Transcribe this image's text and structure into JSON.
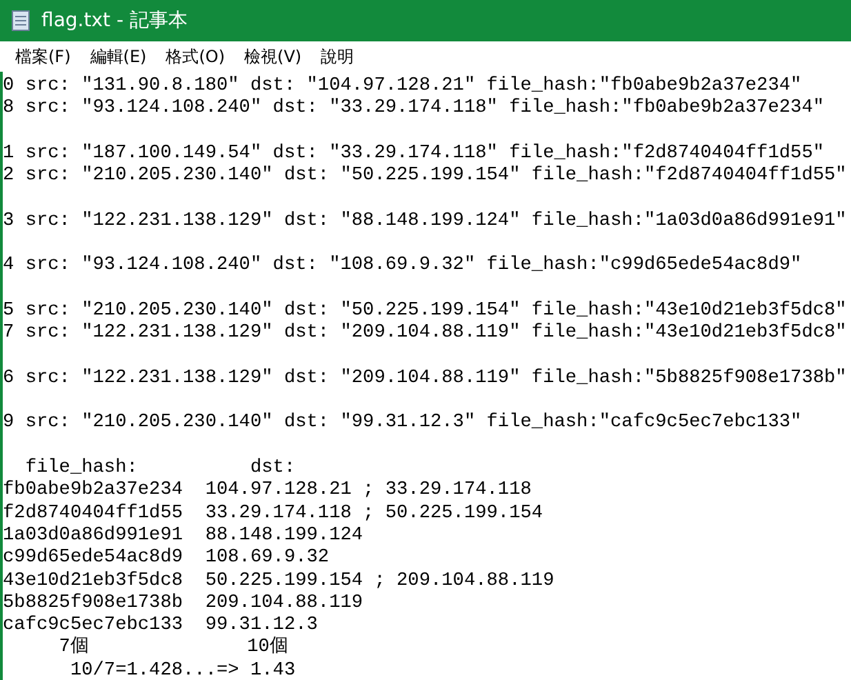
{
  "window": {
    "title": "flag.txt - 記事本"
  },
  "menu": [
    {
      "label": "檔案(F)"
    },
    {
      "label": "編輯(E)"
    },
    {
      "label": "格式(O)"
    },
    {
      "label": "檢視(V)"
    },
    {
      "label": "說明"
    }
  ],
  "document": {
    "blocks": [
      [
        "0 src: \"131.90.8.180\" dst: \"104.97.128.21\" file_hash:\"fb0abe9b2a37e234\"",
        "8 src: \"93.124.108.240\" dst: \"33.29.174.118\" file_hash:\"fb0abe9b2a37e234\""
      ],
      [
        "1 src: \"187.100.149.54\" dst: \"33.29.174.118\" file_hash:\"f2d8740404ff1d55\"",
        "2 src: \"210.205.230.140\" dst: \"50.225.199.154\" file_hash:\"f2d8740404ff1d55\""
      ],
      [
        "3 src: \"122.231.138.129\" dst: \"88.148.199.124\" file_hash:\"1a03d0a86d991e91\""
      ],
      [
        "4 src: \"93.124.108.240\" dst: \"108.69.9.32\" file_hash:\"c99d65ede54ac8d9\""
      ],
      [
        "5 src: \"210.205.230.140\" dst: \"50.225.199.154\" file_hash:\"43e10d21eb3f5dc8\"",
        "7 src: \"122.231.138.129\" dst: \"209.104.88.119\" file_hash:\"43e10d21eb3f5dc8\""
      ],
      [
        "6 src: \"122.231.138.129\" dst: \"209.104.88.119\" file_hash:\"5b8825f908e1738b\""
      ],
      [
        "9 src: \"210.205.230.140\" dst: \"99.31.12.3\" file_hash:\"cafc9c5ec7ebc133\""
      ],
      [
        "  file_hash:          dst:",
        "fb0abe9b2a37e234  104.97.128.21 ; 33.29.174.118",
        "f2d8740404ff1d55  33.29.174.118 ; 50.225.199.154",
        "1a03d0a86d991e91  88.148.199.124",
        "c99d65ede54ac8d9  108.69.9.32",
        "43e10d21eb3f5dc8  50.225.199.154 ; 209.104.88.119",
        "5b8825f908e1738b  209.104.88.119",
        "cafc9c5ec7ebc133  99.31.12.3",
        "     7個              10個",
        "      10/7=1.428...=> 1.43"
      ]
    ]
  }
}
